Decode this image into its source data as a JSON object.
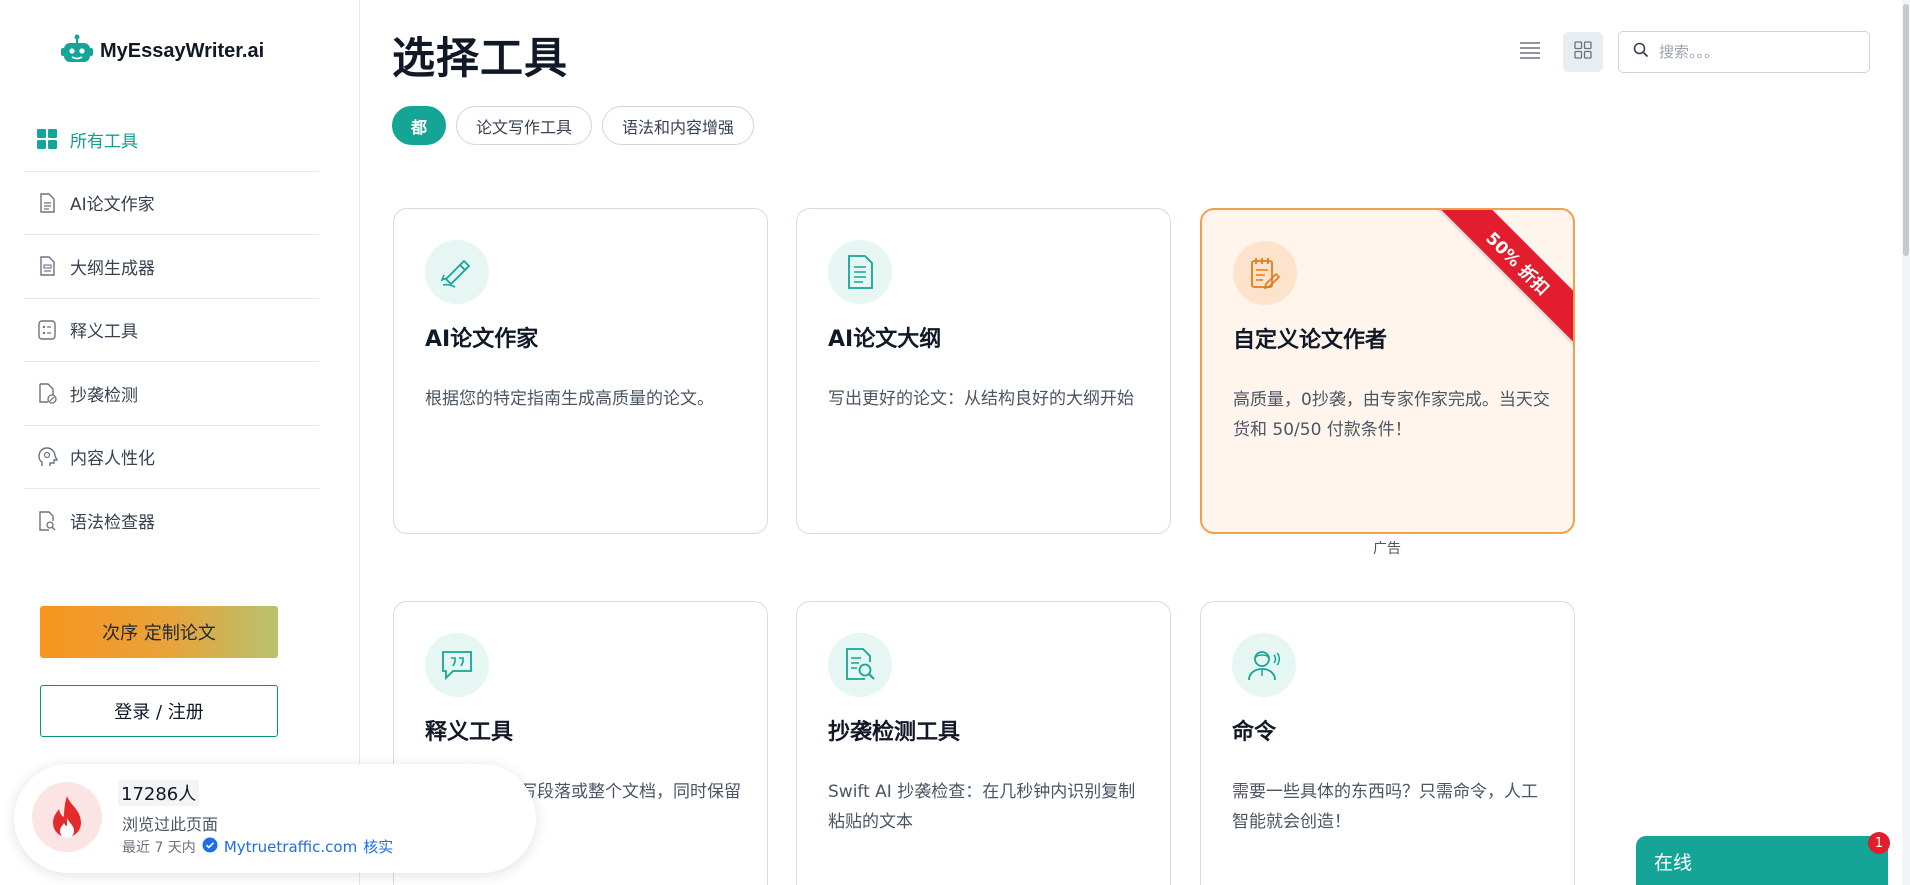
{
  "brand": {
    "name": "MyEssayWriter.ai",
    "accent": "#14a596",
    "ad_accent": "#f0a04b",
    "ribbon_color": "#e11d2e"
  },
  "sidebar": {
    "items": [
      {
        "label": "所有工具",
        "icon": "grid-icon",
        "active": true
      },
      {
        "label": "AI论文作家",
        "icon": "document-icon",
        "active": false
      },
      {
        "label": "大纲生成器",
        "icon": "outline-icon",
        "active": false
      },
      {
        "label": "释义工具",
        "icon": "list-icon",
        "active": false
      },
      {
        "label": "抄袭检测",
        "icon": "check-document-icon",
        "active": false
      },
      {
        "label": "内容人性化",
        "icon": "head-icon",
        "active": false
      },
      {
        "label": "语法检查器",
        "icon": "search-document-icon",
        "active": false
      }
    ],
    "order_button": "次序 定制论文",
    "login_button": "登录 / 注册"
  },
  "main": {
    "title": "选择工具",
    "search": {
      "placeholder": "搜索。。。"
    },
    "filters": [
      {
        "label": "都",
        "active": true
      },
      {
        "label": "论文写作工具",
        "active": false
      },
      {
        "label": "语法和内容增强",
        "active": false
      }
    ],
    "cards": [
      {
        "title": "AI论文作家",
        "desc": "根据您的特定指南生成高质量的论文。",
        "icon": "pen-hand-icon"
      },
      {
        "title": "AI论文大纲",
        "desc": "写出更好的论文：从结构良好的大纲开始",
        "icon": "document-icon"
      },
      {
        "title": "自定义论文作者",
        "desc": "高质量，0抄袭，由专家作家完成。当天交货和 50/50 付款条件！",
        "icon": "notepad-pen-icon",
        "ribbon": "50% 折扣",
        "ad": true
      },
      {
        "title": "释义工具",
        "desc": "改写段落或整个文档，同时保留",
        "icon": "quote-bubble-icon"
      },
      {
        "title": "抄袭检测工具",
        "desc": "Swift AI 抄袭检查：在几秒钟内识别复制粘贴的文本",
        "icon": "magnify-document-icon"
      },
      {
        "title": "命令",
        "desc": "需要一些具体的东西吗？只需命令，人工智能就会创造！",
        "icon": "agent-icon"
      }
    ],
    "ad_label": "广告"
  },
  "proof": {
    "count": "17286人",
    "subtitle": "浏览过此页面",
    "period": "最近 7 天内",
    "source": "Mytruetraffic.com",
    "verified": "核实"
  },
  "chat": {
    "label": "在线",
    "badge": "1"
  }
}
